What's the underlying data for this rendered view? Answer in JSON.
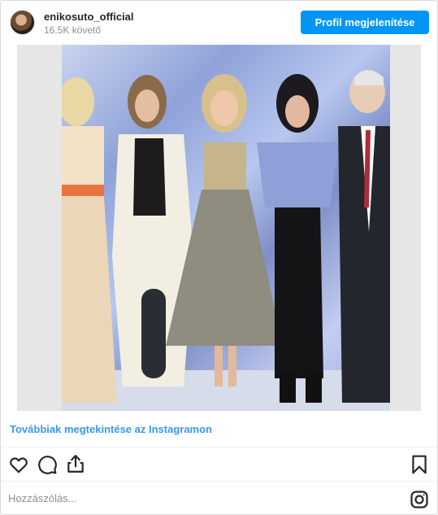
{
  "header": {
    "username": "enikosuto_official",
    "followers": "16.5K követő",
    "profile_button": "Profil megjelenítése"
  },
  "media": {
    "alt": "photo"
  },
  "link": {
    "view_more": "Továbbiak megtekintése az Instagramon"
  },
  "actions": {
    "icons": [
      "heart-icon",
      "comment-icon",
      "share-icon",
      "bookmark-icon"
    ]
  },
  "comment": {
    "placeholder": "Hozzászólás..."
  },
  "colors": {
    "accent": "#0095f6",
    "link": "#3897f0",
    "text": "#262626",
    "muted": "#8e8e8e"
  }
}
